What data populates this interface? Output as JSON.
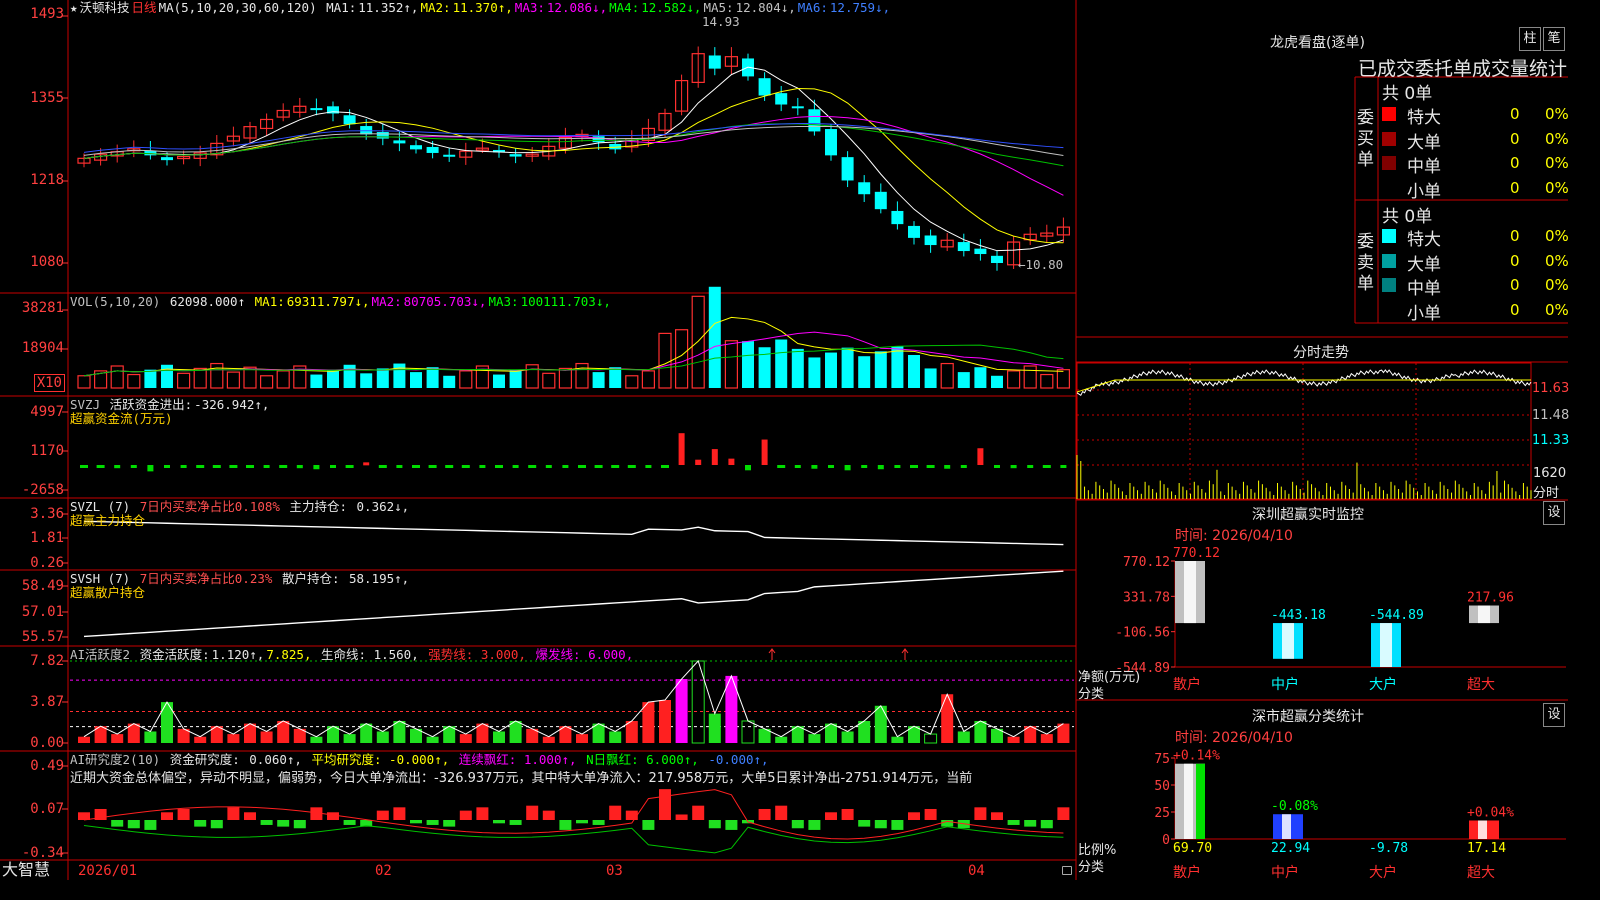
{
  "colors": {
    "up": "#ff3030",
    "down": "#00ffff",
    "grid": "#c00000",
    "ma1": "#ffffff",
    "ma2": "#ffff00",
    "ma3": "#ff00ff",
    "ma4": "#00c000",
    "ma5": "#c0c0c0",
    "ma6": "#3050ff"
  },
  "main": {
    "star": "★",
    "stock_name": "沃顿科技",
    "period": "日线",
    "ma_def": "MA(5,10,20,30,60,120)",
    "ma_items": [
      {
        "label": "MA1:",
        "value": "11.352↑",
        "color": "w"
      },
      {
        "label": "MA2:",
        "value": "11.370↑",
        "color": "y"
      },
      {
        "label": "MA3:",
        "value": "12.086↓",
        "color": "m"
      },
      {
        "label": "MA4:",
        "value": "12.582↓",
        "color": "g"
      },
      {
        "label": "MA5:",
        "value": "12.804↓",
        "color": "gr"
      },
      {
        "label": "MA6:",
        "value": "12.759↓",
        "color": "b"
      }
    ],
    "yticks": [
      "1493",
      "1355",
      "1218",
      "1080"
    ],
    "high_label": "14.93",
    "low_label": "←10.80"
  },
  "vol": {
    "def": "VOL(5,10,20)",
    "value": "62098.000↑",
    "ma_items": [
      {
        "label": "MA1:",
        "value": "69311.797↓",
        "color": "y"
      },
      {
        "label": "MA2:",
        "value": "80705.703↓",
        "color": "m"
      },
      {
        "label": "MA3:",
        "value": "100111.703↓",
        "color": "g"
      }
    ],
    "yticks": [
      "38281",
      "18904"
    ],
    "unit": "X10"
  },
  "svzj": {
    "def": "SVZJ",
    "label": "活跃资金进出:",
    "value": "-326.942↑,",
    "sub": "超赢资金流(万元)",
    "yticks": [
      "4997",
      "1170",
      "-2658"
    ]
  },
  "svzl": {
    "def": "SVZL (7)",
    "label1": "7日内买卖净占比0.108%",
    "label2": "主力持仓:",
    "value": "0.362↓,",
    "sub": "超赢主力持仓",
    "yticks": [
      "3.36",
      "1.81",
      "0.26"
    ]
  },
  "svsh": {
    "def": "SVSH (7)",
    "label1": "7日内买卖净占比0.23%",
    "label2": "散户持仓:",
    "value": "58.195↑,",
    "sub": "超赢散户持仓",
    "yticks": [
      "58.49",
      "57.01",
      "55.57"
    ]
  },
  "ai1": {
    "def": "AI活跃度2",
    "label": "资金活跃度:",
    "value1": "1.120↑,",
    "value2": "7.825,",
    "life": "生命线: 1.560,",
    "strong": "强势线: 3.000,",
    "burst": "爆发线: 6.000,",
    "yticks": [
      "7.82",
      "3.87",
      "0.00"
    ]
  },
  "ai2": {
    "def": "AI研究度2(10)",
    "label": "资金研究度:",
    "value": "0.060↑,",
    "avg": "平均研究度: -0.000↑,",
    "lianxu": "连续飘红: 1.000↑,",
    "nri": "N日飘红: 6.000↑,",
    "last": "-0.000↑,",
    "note": "近期大资金总体偏空，异动不明显，偏弱势，今日大单净流出：-326.937万元，其中特大单净流入：217.958万元，大单5日累计净出-2751.914万元，当前",
    "yticks": [
      "0.49",
      "0.07",
      "-0.34"
    ]
  },
  "xaxis": {
    "brand": "大智慧",
    "labels": [
      "2026/01",
      "02",
      "03",
      "04"
    ]
  },
  "longhu": {
    "title": "龙虎看盘(逐单)",
    "btn1": "柱",
    "btn2": "笔",
    "header": "已成交委托单成交量统计",
    "buy_side": "委买单",
    "sell_side": "委卖单",
    "buy_total": "共 0单",
    "sell_total": "共 0单",
    "buy_rows": [
      {
        "name": "特大",
        "v": "0",
        "p": "0%",
        "color": "#ff0000"
      },
      {
        "name": "大单",
        "v": "0",
        "p": "0%",
        "color": "#a00000"
      },
      {
        "name": "中单",
        "v": "0",
        "p": "0%",
        "color": "#800000"
      },
      {
        "name": "小单",
        "v": "0",
        "p": "0%",
        "color": ""
      }
    ],
    "sell_rows": [
      {
        "name": "特大",
        "v": "0",
        "p": "0%",
        "color": "#00ffff"
      },
      {
        "name": "大单",
        "v": "0",
        "p": "0%",
        "color": "#00a0a0"
      },
      {
        "name": "中单",
        "v": "0",
        "p": "0%",
        "color": "#008080"
      },
      {
        "name": "小单",
        "v": "0",
        "p": "0%",
        "color": ""
      }
    ]
  },
  "intraday": {
    "title": "分时走势",
    "ylabels": [
      "11.63",
      "11.48",
      "11.33"
    ],
    "vol_labels": [
      "1620",
      "分时"
    ]
  },
  "monitor": {
    "title": "深圳超赢实时监控",
    "btn": "设",
    "date": "时间: 2026/04/10",
    "ylabel": "净额(万元)",
    "xlabel": "分类",
    "yticks": [
      "770.12",
      "331.78",
      "-106.56",
      "-544.89"
    ],
    "chart_data": {
      "type": "bar",
      "categories": [
        "散户",
        "中户",
        "大户",
        "超大"
      ],
      "values": [
        770.12,
        -443.18,
        -544.89,
        217.96
      ],
      "ylim": [
        -544.89,
        770.12
      ]
    }
  },
  "classify": {
    "title": "深市超赢分类统计",
    "btn": "设",
    "date": "时间: 2026/04/10",
    "ylabel": "比例%",
    "xlabel": "分类",
    "yticks": [
      "75",
      "50",
      "25",
      "0"
    ],
    "chart_data": {
      "type": "bar",
      "categories": [
        "散户",
        "中户",
        "大户",
        "超大"
      ],
      "values": [
        69.7,
        22.94,
        -9.78,
        17.14
      ],
      "top_labels": [
        "+0.14%",
        "-0.08%",
        "",
        "+0.04%"
      ],
      "ylim": [
        0,
        75
      ]
    }
  }
}
